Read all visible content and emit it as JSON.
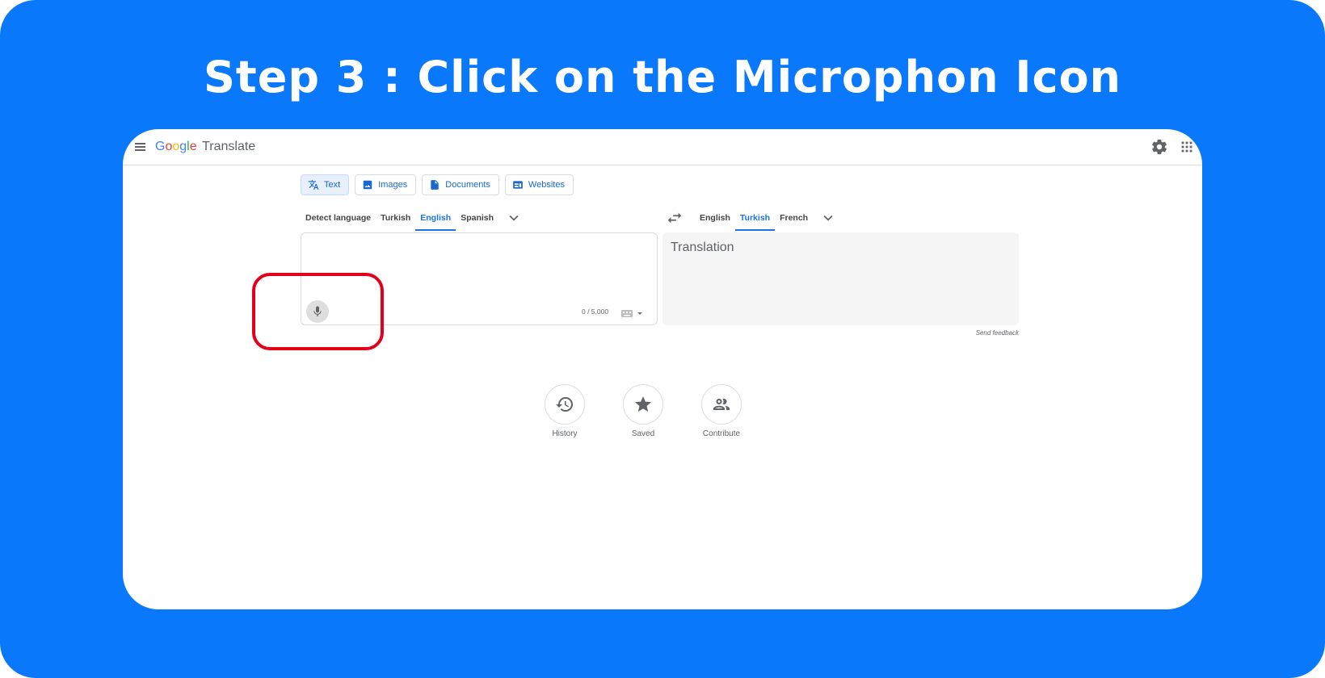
{
  "headline": "Step 3 : Click on the Microphon Icon",
  "colors": {
    "background": "#0a78fb",
    "accent": "#1a73e8",
    "highlight": "#e3001b"
  },
  "topbar": {
    "logo_letters": [
      "G",
      "o",
      "o",
      "g",
      "l",
      "e"
    ],
    "product": "Translate",
    "icons": [
      "menu-icon",
      "settings-icon",
      "apps-grid-icon"
    ]
  },
  "modes": [
    {
      "label": "Text",
      "icon": "translate-icon",
      "active": true
    },
    {
      "label": "Images",
      "icon": "image-icon"
    },
    {
      "label": "Documents",
      "icon": "document-icon"
    },
    {
      "label": "Websites",
      "icon": "website-icon"
    }
  ],
  "source_langs": [
    "Detect language",
    "Turkish",
    "English",
    "Spanish"
  ],
  "source_active": "English",
  "target_langs": [
    "English",
    "Turkish",
    "French"
  ],
  "target_active": "Turkish",
  "source": {
    "value": "",
    "char_count": "0 / 5,000"
  },
  "target": {
    "placeholder": "Translation"
  },
  "feedback": "Send feedback",
  "quick": [
    {
      "label": "History",
      "icon": "history-icon"
    },
    {
      "label": "Saved",
      "icon": "star-icon"
    },
    {
      "label": "Contribute",
      "icon": "contribute-icon"
    }
  ]
}
